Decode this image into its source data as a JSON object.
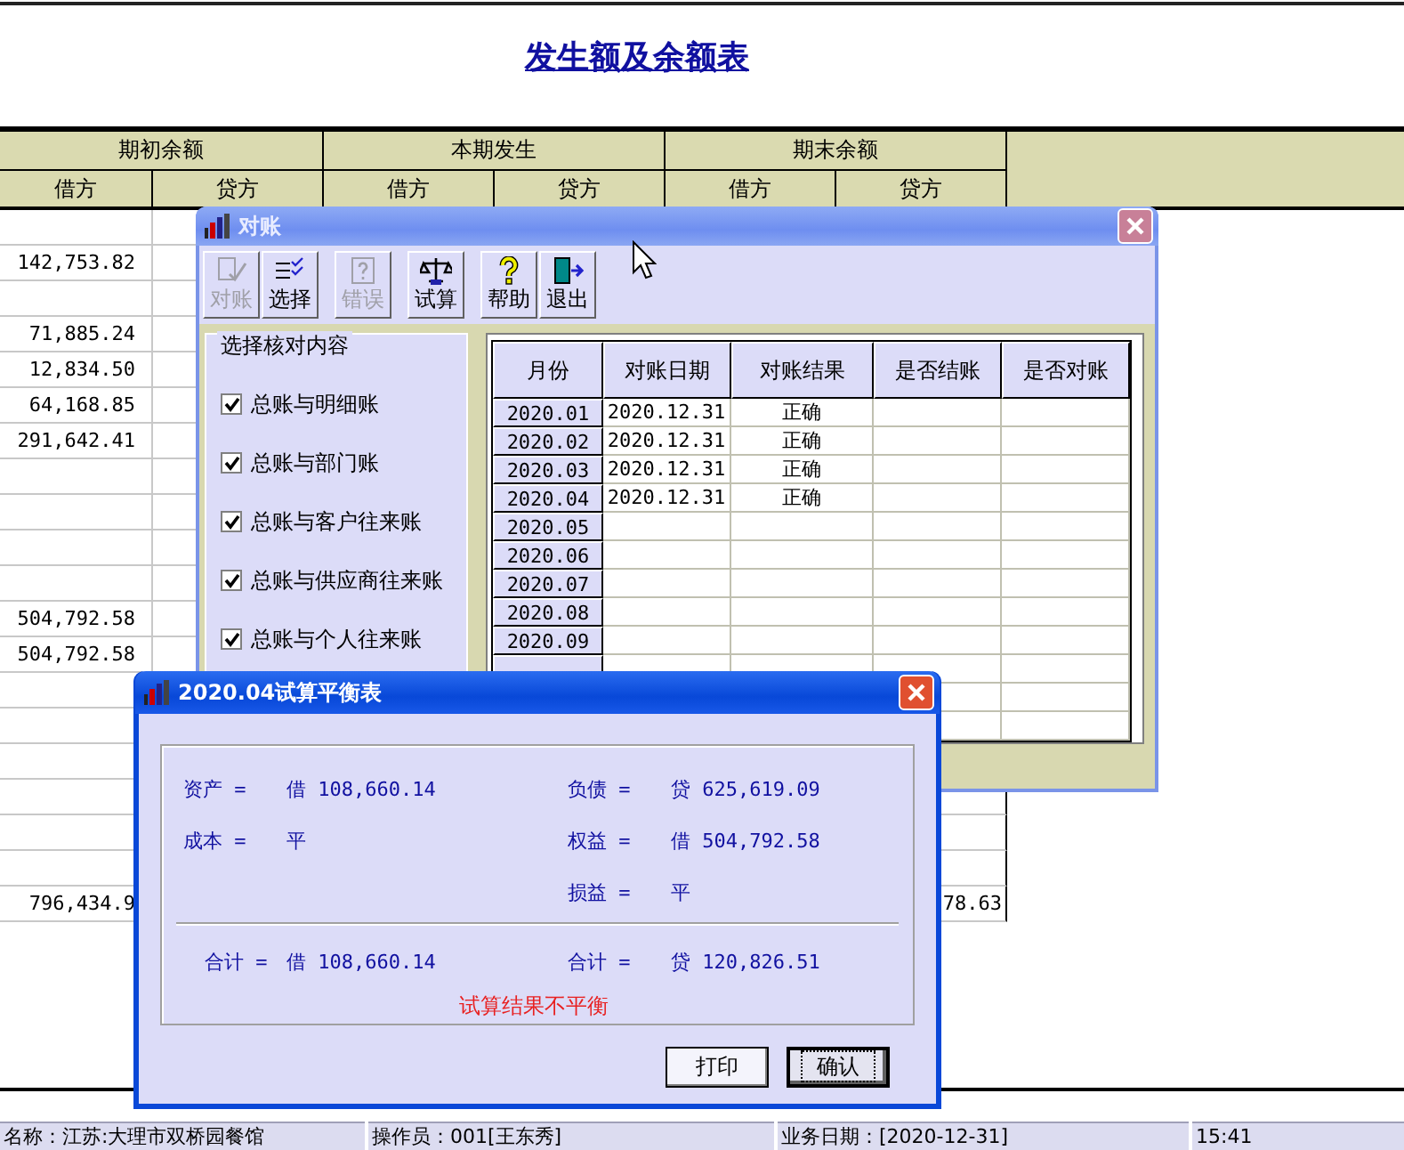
{
  "report": {
    "title": "发生额及余额表",
    "groups": [
      "期初余额",
      "本期发生",
      "期末余额"
    ],
    "subcolumns": [
      "借方",
      "贷方",
      "借方",
      "贷方",
      "借方",
      "贷方"
    ],
    "rows": [
      {},
      {
        "opening_debit": "142,753.82"
      },
      {},
      {
        "opening_debit": "71,885.24"
      },
      {
        "opening_debit": "12,834.50"
      },
      {
        "opening_debit": "64,168.85"
      },
      {
        "opening_debit": "291,642.41"
      },
      {},
      {},
      {},
      {},
      {
        "opening_debit": "504,792.58"
      },
      {
        "opening_debit": "504,792.58"
      },
      {},
      {},
      {},
      {},
      {},
      {},
      {
        "opening_debit": "796,434.9",
        "closing_credit": "78.63"
      }
    ]
  },
  "reconcile_window": {
    "title": "对账",
    "active": false,
    "toolbar": [
      {
        "label": "对账",
        "kind": "reconcile",
        "disabled": true
      },
      {
        "label": "选择",
        "kind": "select",
        "disabled": false
      },
      {
        "label": "错误",
        "kind": "error",
        "disabled": true
      },
      {
        "label": "试算",
        "kind": "trial",
        "disabled": false
      },
      {
        "label": "帮助",
        "kind": "help",
        "disabled": false
      },
      {
        "label": "退出",
        "kind": "exit",
        "disabled": false
      }
    ],
    "check_group": {
      "title": "选择核对内容",
      "items": [
        {
          "label": "总账与明细账",
          "checked": true
        },
        {
          "label": "总账与部门账",
          "checked": true
        },
        {
          "label": "总账与客户往来账",
          "checked": true
        },
        {
          "label": "总账与供应商往来账",
          "checked": true
        },
        {
          "label": "总账与个人往来账",
          "checked": true
        }
      ]
    },
    "table": {
      "columns": [
        "月份",
        "对账日期",
        "对账结果",
        "是否结账",
        "是否对账"
      ],
      "rows": [
        {
          "month": "2020.01",
          "date": "2020.12.31",
          "result": "正确"
        },
        {
          "month": "2020.02",
          "date": "2020.12.31",
          "result": "正确"
        },
        {
          "month": "2020.03",
          "date": "2020.12.31",
          "result": "正确"
        },
        {
          "month": "2020.04",
          "date": "2020.12.31",
          "result": "正确"
        },
        {
          "month": "2020.05"
        },
        {
          "month": "2020.06"
        },
        {
          "month": "2020.07"
        },
        {
          "month": "2020.08"
        },
        {
          "month": "2020.09"
        }
      ]
    }
  },
  "trial_window": {
    "title": "2020.04试算平衡表",
    "active": true,
    "rows": [
      {
        "left": {
          "label": "资产 =",
          "value": "借 108,660.14"
        },
        "right": {
          "label": "负债 =",
          "value": "贷 625,619.09"
        }
      },
      {
        "left": {
          "label": "成本 =",
          "value": "平"
        },
        "right": {
          "label": "权益 =",
          "value": "借 504,792.58"
        }
      },
      {
        "right": {
          "label": "损益 =",
          "value": "平"
        }
      }
    ],
    "total": {
      "left": {
        "label": "合计 =",
        "value": "借 108,660.14"
      },
      "right": {
        "label": "合计 =",
        "value": "贷 120,826.51"
      }
    },
    "message": "试算结果不平衡",
    "buttons": [
      {
        "label": "打印",
        "focused": false
      },
      {
        "label": "确认",
        "focused": true
      }
    ]
  },
  "status_bar": [
    "名称：江苏:大理市双桥园餐馆",
    "操作员：001[王东秀]",
    "业务日期：[2020-12-31]",
    "15:41"
  ]
}
